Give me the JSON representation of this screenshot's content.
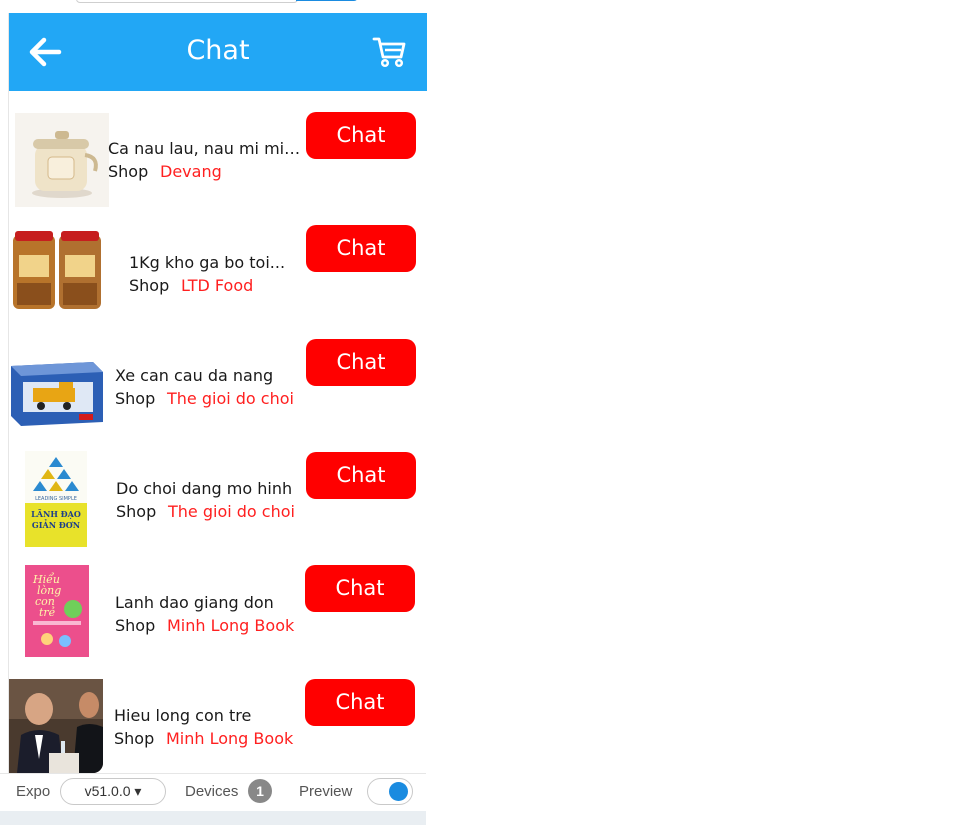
{
  "header": {
    "title": "Chat"
  },
  "items": [
    {
      "name": "Ca nau lau, nau mi mini...",
      "shop_label": "Shop",
      "shop_name": "Devang",
      "button": "Chat"
    },
    {
      "name": "1Kg kho ga bo toi...",
      "shop_label": "Shop",
      "shop_name": "LTD Food",
      "button": "Chat"
    },
    {
      "name": "Xe can cau da nang",
      "shop_label": "Shop",
      "shop_name": "The gioi do choi",
      "button": "Chat"
    },
    {
      "name": "Do choi dang mo hinh",
      "shop_label": "Shop",
      "shop_name": "The gioi do choi",
      "button": "Chat"
    },
    {
      "name": "Lanh dao giang don",
      "shop_label": "Shop",
      "shop_name": "Minh Long Book",
      "button": "Chat"
    },
    {
      "name": "Hieu long con tre",
      "shop_label": "Shop",
      "shop_name": "Minh Long Book",
      "button": "Chat"
    }
  ],
  "thumbnails": [
    {
      "icon": "rice-cooker-image"
    },
    {
      "icon": "jars-image",
      "label": ""
    },
    {
      "icon": "toy-crane-box-image"
    },
    {
      "icon": "book-cover-image",
      "lines": [
        "LEADING SIMPLE",
        "LÃNH ĐẠO",
        "GIẢN ĐƠN"
      ]
    },
    {
      "icon": "book-cover-image",
      "lines": [
        "Hiểu",
        "lòng",
        "con",
        "trẻ"
      ]
    },
    {
      "icon": "photo-people-image"
    }
  ],
  "bottom_bar": {
    "expo_label": "Expo",
    "version": "v51.0.0 ▾",
    "devices_label": "Devices",
    "devices_count": "1",
    "preview_label": "Preview",
    "preview_on": true
  },
  "colors": {
    "header": "#22a7f5",
    "chat_button": "#ff0000",
    "shop_name": "#ff2020"
  }
}
